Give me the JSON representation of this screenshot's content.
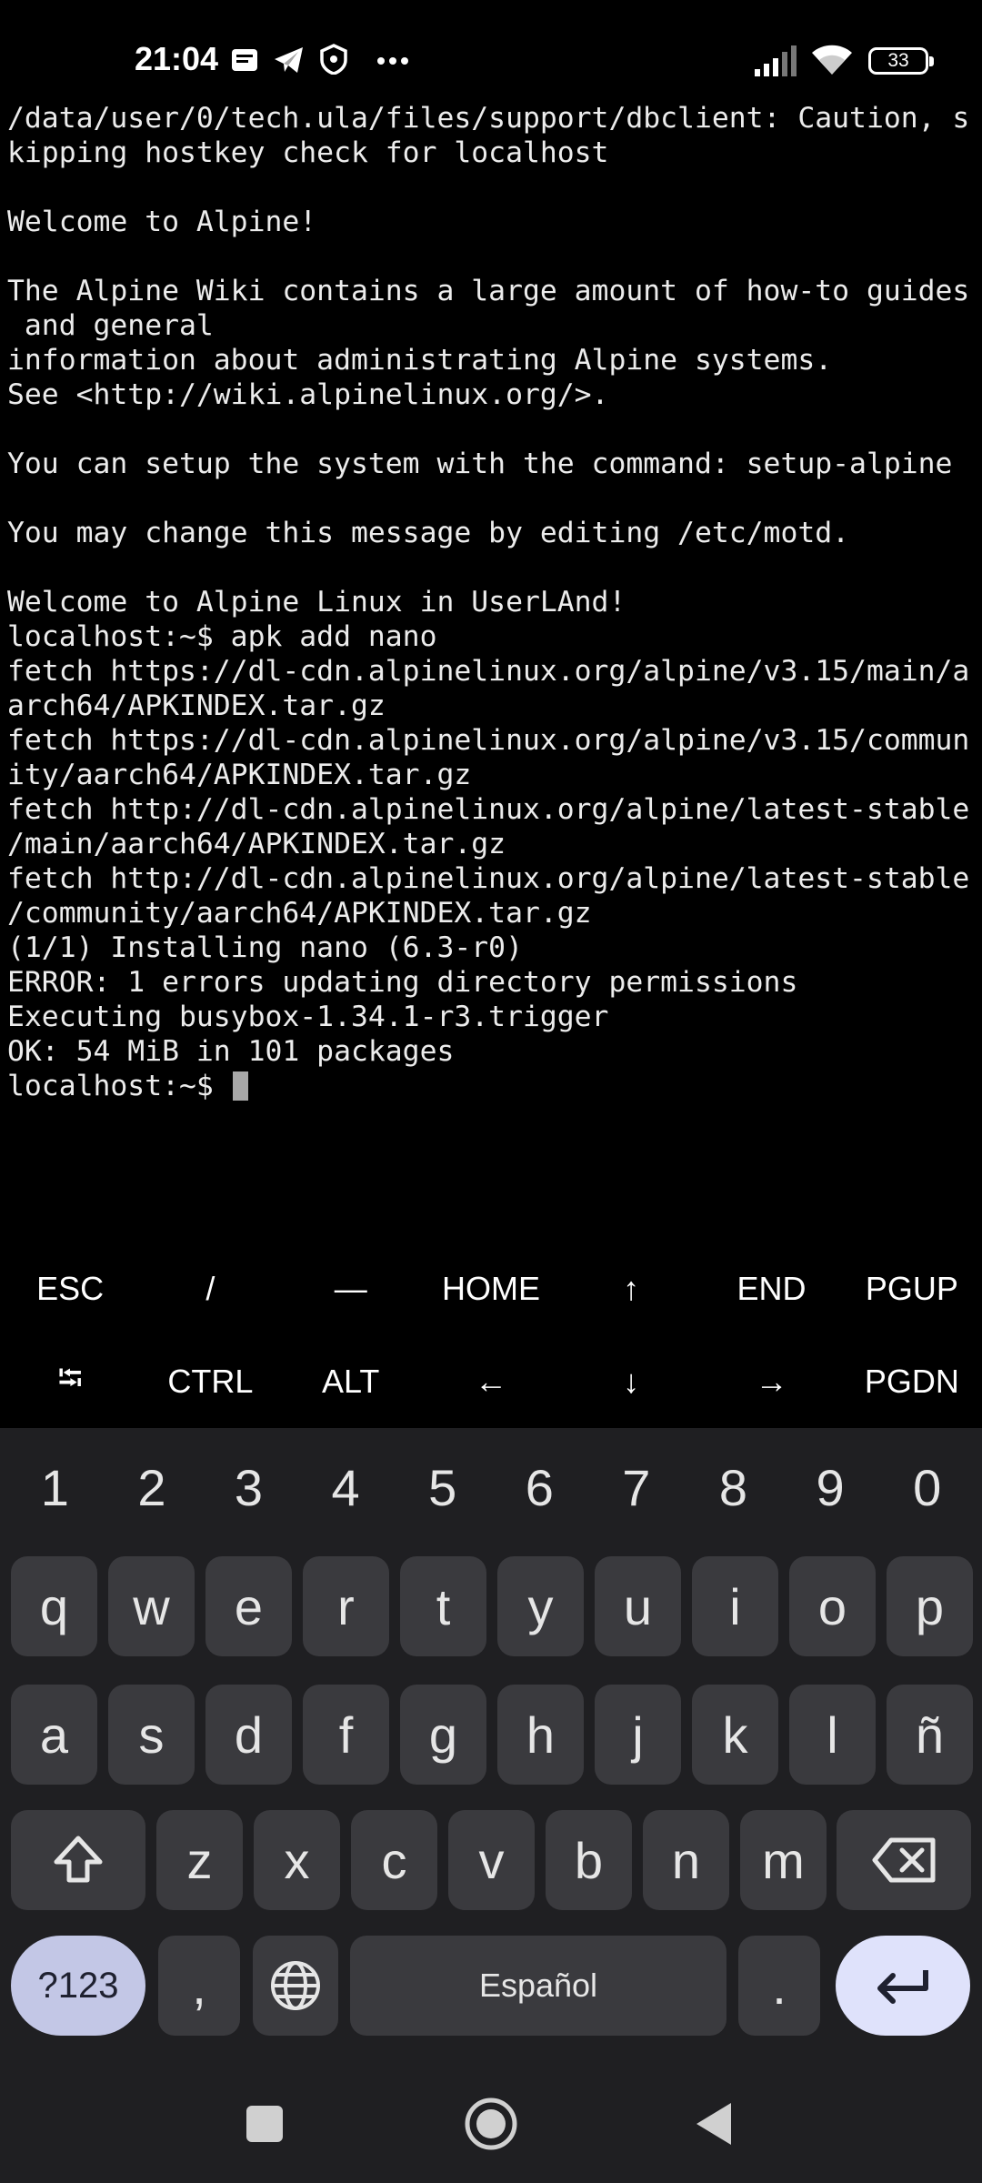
{
  "status_bar": {
    "time": "21:04",
    "battery": "33",
    "icons": [
      "message-icon",
      "telegram-icon",
      "shield-icon",
      "more-dots-icon",
      "signal-icon",
      "wifi-icon",
      "battery-icon"
    ]
  },
  "terminal": {
    "lines": [
      "/data/user/0/tech.ula/files/support/dbclient: Caution, s",
      "kipping hostkey check for localhost",
      "",
      "Welcome to Alpine!",
      "",
      "The Alpine Wiki contains a large amount of how-to guides",
      " and general",
      "information about administrating Alpine systems.",
      "See <http://wiki.alpinelinux.org/>.",
      "",
      "You can setup the system with the command: setup-alpine",
      "",
      "You may change this message by editing /etc/motd.",
      "",
      "Welcome to Alpine Linux in UserLAnd!",
      "localhost:~$ apk add nano",
      "fetch https://dl-cdn.alpinelinux.org/alpine/v3.15/main/a",
      "arch64/APKINDEX.tar.gz",
      "fetch https://dl-cdn.alpinelinux.org/alpine/v3.15/commun",
      "ity/aarch64/APKINDEX.tar.gz",
      "fetch http://dl-cdn.alpinelinux.org/alpine/latest-stable",
      "/main/aarch64/APKINDEX.tar.gz",
      "fetch http://dl-cdn.alpinelinux.org/alpine/latest-stable",
      "/community/aarch64/APKINDEX.tar.gz",
      "(1/1) Installing nano (6.3-r0)",
      "ERROR: 1 errors updating directory permissions",
      "Executing busybox-1.34.1-r3.trigger",
      "OK: 54 MiB in 101 packages"
    ],
    "prompt": "localhost:~$ "
  },
  "extra_keys": {
    "row1": [
      "ESC",
      "/",
      "—",
      "HOME",
      "↑",
      "END",
      "PGUP"
    ],
    "row2": [
      "⭾",
      "CTRL",
      "ALT",
      "←",
      "↓",
      "→",
      "PGDN"
    ]
  },
  "keyboard": {
    "numbers": [
      "1",
      "2",
      "3",
      "4",
      "5",
      "6",
      "7",
      "8",
      "9",
      "0"
    ],
    "row1": [
      "q",
      "w",
      "e",
      "r",
      "t",
      "y",
      "u",
      "i",
      "o",
      "p"
    ],
    "row2": [
      "a",
      "s",
      "d",
      "f",
      "g",
      "h",
      "j",
      "k",
      "l",
      "ñ"
    ],
    "row3": [
      "z",
      "x",
      "c",
      "v",
      "b",
      "n",
      "m"
    ],
    "symbols_label": "?123",
    "comma": ",",
    "space_label": "Español",
    "period": "."
  },
  "nav_bar": {
    "icons": [
      "recents-icon",
      "home-icon",
      "back-icon"
    ]
  }
}
